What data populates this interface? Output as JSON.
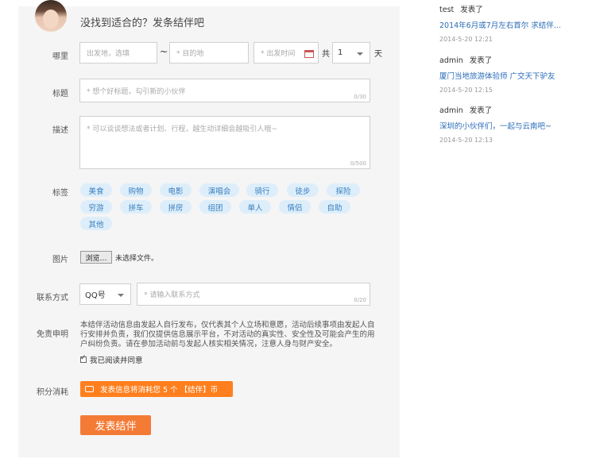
{
  "header": {
    "title": "没找到适合的？发条结伴吧"
  },
  "form": {
    "where": {
      "label": "哪里",
      "from_placeholder": "出发地，选填",
      "tilde": "~",
      "to_placeholder": "* 目的地",
      "date_placeholder": "* 出发时间",
      "total_label": "共",
      "days_value": "1",
      "days_unit": "天"
    },
    "title": {
      "label": "标题",
      "placeholder": "* 想个好标题，勾引新的小伙伴",
      "counter": "0/30"
    },
    "desc": {
      "label": "描述",
      "placeholder": "* 可以谈谈想法或者计划、行程，越生动详细会越吸引人哦~",
      "counter": "0/500"
    },
    "tags": {
      "label": "标签",
      "items": [
        "美食",
        "购物",
        "电影",
        "演唱会",
        "骑行",
        "徒步",
        "探险",
        "穷游",
        "拼车",
        "拼房",
        "组团",
        "单人",
        "情侣",
        "自助",
        "其他"
      ]
    },
    "image": {
      "label": "图片",
      "browse": "浏览…",
      "no_file": "未选择文件。"
    },
    "contact": {
      "label": "联系方式",
      "type_value": "QQ号",
      "placeholder": "* 请输入联系方式",
      "counter": "0/20"
    },
    "disclaimer": {
      "label": "免责申明",
      "text": "本结伴活动信息由发起人自行发布，仅代表其个人立场和意愿，活动后续事项由发起人自行安排并负责，我们仅提供信息展示平台，不对活动的真实性、安全性及可能会产生的用户纠纷负责。请在参加活动前与发起人核实相关情况，注意人身与财产安全。",
      "agree": "我已阅读并同意"
    },
    "points": {
      "label": "积分消耗",
      "notice": "发表信息将消耗您 5 个 【结伴】币"
    },
    "submit": "发表结伴"
  },
  "feed": [
    {
      "user": "test",
      "action": "发表了",
      "title": "2014年6月或7月左右首尔 求结伴...",
      "time": "2014-5-20 12:21"
    },
    {
      "user": "admin",
      "action": "发表了",
      "title": "厦门当地旅游体验师 广交天下驴友",
      "time": "2014-5-20 12:15"
    },
    {
      "user": "admin",
      "action": "发表了",
      "title": "深圳的小伙伴们，一起与云南吧~",
      "time": "2014-5-20 12:13"
    }
  ],
  "colors": {
    "accent": "#f47b36",
    "link": "#2b6cb8",
    "tag_bg": "#ddeefa",
    "tag_text": "#3a7fbf"
  }
}
